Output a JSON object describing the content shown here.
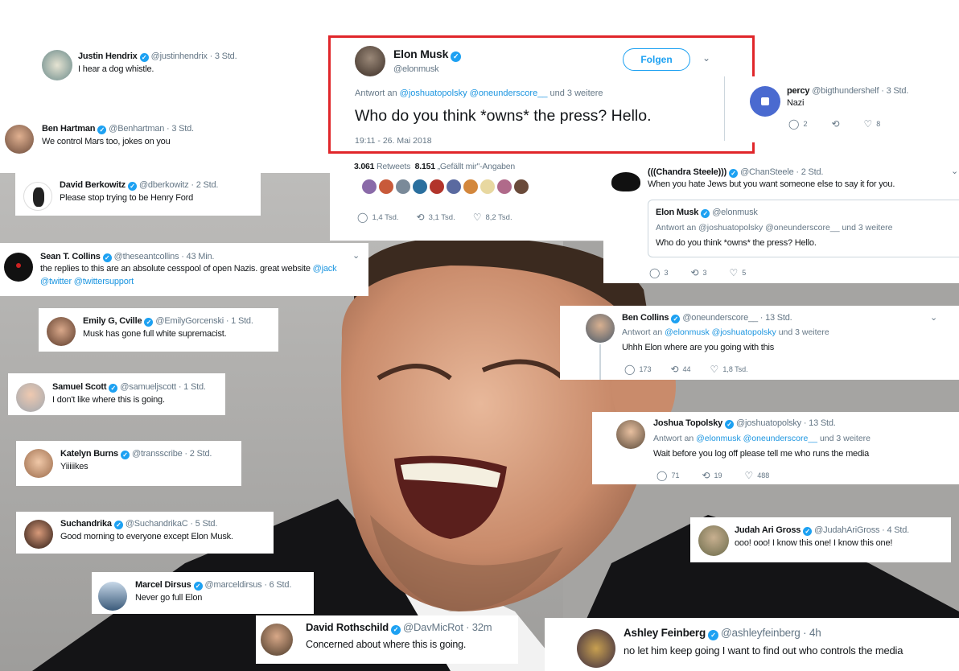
{
  "main_tweet": {
    "name": "Elon Musk",
    "handle": "@elonmusk",
    "follow_label": "Folgen",
    "reply_prefix": "Antwort an",
    "reply_users": "@joshuatopolsky @oneunderscore__",
    "reply_suffix": "und 3 weitere",
    "text": "Who do you think *owns* the press? Hello.",
    "timestamp": "19:11 - 26. Mai 2018",
    "retweets_count": "3.061",
    "retweets_label": "Retweets",
    "likes_count": "8.151",
    "likes_label": "„Gefällt mir\"-Angaben",
    "reply_count": "1,4 Tsd.",
    "retweet_count": "3,1 Tsd.",
    "like_count": "8,2 Tsd.",
    "highlight_color": "#e0262a"
  },
  "tweets_left": [
    {
      "name": "Justin Hendrix",
      "handle": "@justinhendrix · 3 Std.",
      "text": "I hear a dog whistle."
    },
    {
      "name": "Ben Hartman",
      "handle": "@Benhartman · 3 Std.",
      "text": "We control Mars too, jokes on you"
    },
    {
      "name": "David Berkowitz",
      "handle": "@dberkowitz · 2 Std.",
      "text": "Please stop trying to be Henry Ford"
    },
    {
      "name": "Sean T. Collins",
      "handle": "@theseantcollins · 43 Min.",
      "text_a": "the replies to this are an absolute cesspool of open Nazis. great website",
      "link1": "@jack",
      "link2": "@twitter @twittersupport"
    },
    {
      "name": "Emily G, Cville",
      "handle": "@EmilyGorcenski · 1 Std.",
      "text": "Musk has gone full white supremacist."
    },
    {
      "name": "Samuel Scott",
      "handle": "@samueljscott · 1 Std.",
      "text": "I don't like where this is going."
    },
    {
      "name": "Katelyn Burns",
      "handle": "@transscribe · 2 Std.",
      "text": "Yiiiiikes"
    },
    {
      "name": "Suchandrika",
      "handle": "@SuchandrikaC · 5 Std.",
      "text": "Good morning to everyone except Elon Musk."
    },
    {
      "name": "Marcel Dirsus",
      "handle": "@marceldirsus · 6 Std.",
      "text": "Never go full Elon"
    },
    {
      "name": "David Rothschild",
      "handle": "@DavMicRot · 32m",
      "text": "Concerned about where this is going."
    }
  ],
  "percy": {
    "name": "percy",
    "handle": "@bigthundershelf · 3 Std.",
    "text": "Nazi",
    "replies": "2",
    "likes": "8"
  },
  "chandra": {
    "name": "(((Chandra Steele)))",
    "handle": "@ChanSteele · 2 Std.",
    "text": "When you hate Jews but you want someone else to say it for you.",
    "quote_name": "Elon Musk",
    "quote_handle": "@elonmusk",
    "quote_reply": "Antwort an @joshuatopolsky @oneunderscore__ und 3 weitere",
    "quote_text": "Who do you think *owns* the press? Hello.",
    "replies": "3",
    "retweets": "3",
    "likes": "5"
  },
  "ben_collins": {
    "name": "Ben Collins",
    "handle": "@oneunderscore__ · 13 Std.",
    "reply_prefix": "Antwort an",
    "reply_users": "@elonmusk @joshuatopolsky",
    "reply_suffix": "und 3 weitere",
    "text": "Uhhh Elon where are you going with this",
    "replies": "173",
    "retweets": "44",
    "likes": "1,8 Tsd."
  },
  "joshua": {
    "name": "Joshua Topolsky",
    "handle": "@joshuatopolsky · 13 Std.",
    "reply_prefix": "Antwort an",
    "reply_users": "@elonmusk @oneunderscore__",
    "reply_suffix": "und 3 weitere",
    "text": "Wait before you log off please tell me who runs the media",
    "replies": "71",
    "retweets": "19",
    "likes": "488"
  },
  "judah": {
    "name": "Judah Ari Gross",
    "handle": "@JudahAriGross · 4 Std.",
    "text": "ooo! ooo! I know this one! I know this one!"
  },
  "ashley": {
    "name": "Ashley Feinberg",
    "handle": "@ashleyfeinberg · 4h",
    "text": "no let him keep going I want to find out who controls the media"
  },
  "icons": [
    "verified-badge-icon",
    "reply-icon",
    "retweet-icon",
    "heart-icon",
    "chevron-down-icon"
  ]
}
